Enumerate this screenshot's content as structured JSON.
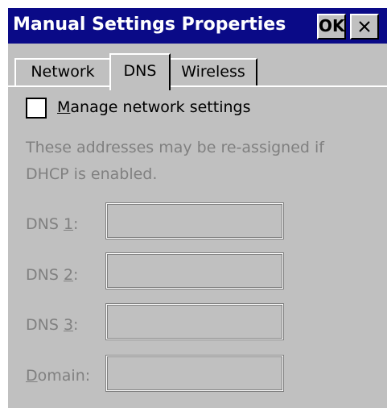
{
  "window": {
    "title": "Manual Settings Properties",
    "ok_label": "OK",
    "close_icon": "close-icon"
  },
  "tabs": [
    {
      "label": "Network",
      "active": false
    },
    {
      "label": "DNS",
      "active": true
    },
    {
      "label": "Wireless",
      "active": false
    }
  ],
  "manage": {
    "label_accel": "M",
    "label_rest": "anage network settings",
    "checked": false
  },
  "note": "These addresses may be re-assigned if DHCP is enabled.",
  "fields": [
    {
      "label_pre": "DNS ",
      "accel": "1",
      "label_post": ":",
      "value": ""
    },
    {
      "label_pre": "DNS ",
      "accel": "2",
      "label_post": ":",
      "value": ""
    },
    {
      "label_pre": "DNS ",
      "accel": "3",
      "label_post": ":",
      "value": ""
    },
    {
      "label_pre": "",
      "accel": "D",
      "label_post": "omain:",
      "value": ""
    }
  ],
  "colors": {
    "titlebar": "#0a0a87",
    "surface": "#c0c0c0",
    "disabled_text": "#808080"
  }
}
